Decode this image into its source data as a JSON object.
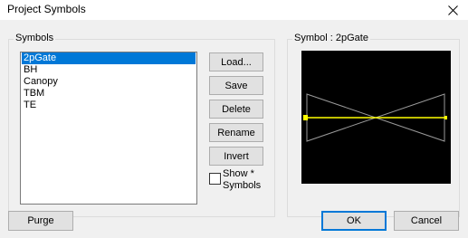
{
  "window": {
    "title": "Project Symbols",
    "close_glyph": "✕"
  },
  "symbols_group": {
    "label": "Symbols",
    "items": [
      "2pGate",
      "BH",
      "Canopy",
      "TBM",
      "TE"
    ],
    "selected_index": 0
  },
  "buttons": {
    "load": "Load...",
    "save": "Save",
    "delete": "Delete",
    "rename": "Rename",
    "invert": "Invert",
    "purge": "Purge",
    "ok": "OK",
    "cancel": "Cancel"
  },
  "show_symbols": {
    "line1": "Show *",
    "line2": "Symbols",
    "checked": false
  },
  "preview_group": {
    "label": "Symbol : 2pGate"
  },
  "colors": {
    "canvas_bg": "#000000",
    "symbol_line": "#ffff00",
    "symbol_outline": "#9a9a9a",
    "selection": "#0078d7"
  }
}
